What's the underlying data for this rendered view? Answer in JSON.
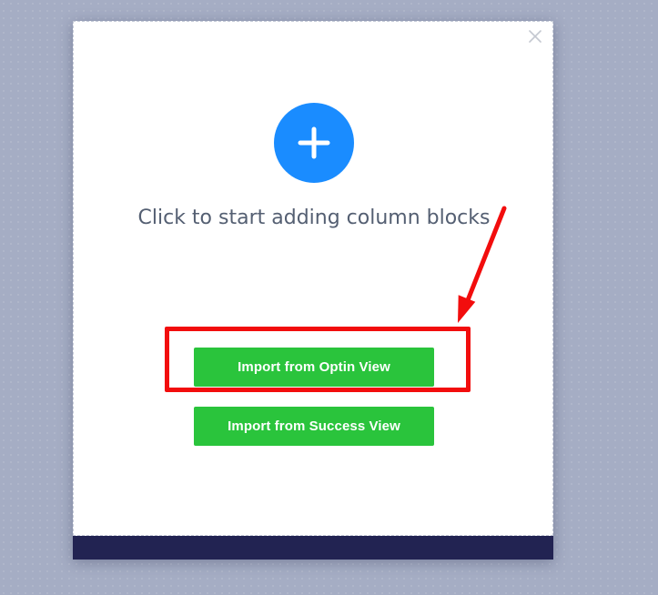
{
  "modal": {
    "prompt": "Click to start adding column blocks",
    "add_icon": "plus-icon",
    "close_icon": "close-icon",
    "buttons": {
      "import_optin": "Import from Optin View",
      "import_success": "Import from Success View"
    }
  },
  "colors": {
    "overlay": "#a5adc4",
    "accent_blue": "#1a8cff",
    "button_green": "#2ac43c",
    "footer_navy": "#222352",
    "annotation_red": "#f20d0d"
  },
  "annotation": {
    "highlight_target": "import-optin-button",
    "arrow_icon": "arrow-icon"
  }
}
